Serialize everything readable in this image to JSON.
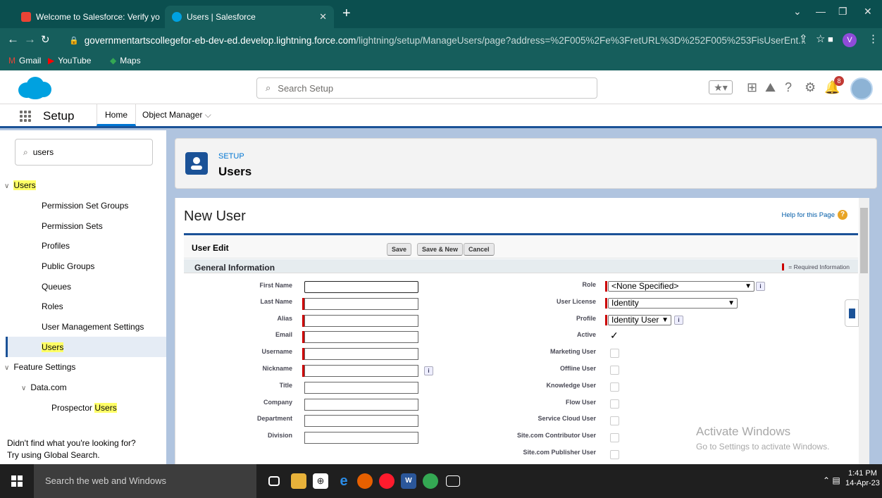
{
  "browser": {
    "tabs": [
      {
        "title": "Welcome to Salesforce: Verify yo",
        "active": false
      },
      {
        "title": "Users | Salesforce",
        "active": true
      }
    ],
    "url_main": "governmentartscollegefor-eb-dev-ed.develop.lightning.force.com",
    "url_path": "/lightning/setup/ManageUsers/page?address=%2F005%2Fe%3FretURL%3D%252F005%253FisUserEnt...",
    "profile_initial": "V",
    "bookmarks": [
      "Gmail",
      "YouTube",
      "Maps"
    ]
  },
  "header": {
    "search_placeholder": "Search Setup",
    "notification_count": "8"
  },
  "nav": {
    "app_name": "Setup",
    "tabs": [
      "Home",
      "Object Manager"
    ]
  },
  "sidebar": {
    "quickfind_value": "users",
    "group_users": "Users",
    "items": [
      "Permission Set Groups",
      "Permission Sets",
      "Profiles",
      "Public Groups",
      "Queues",
      "Roles",
      "User Management Settings",
      "Users"
    ],
    "feature_settings": "Feature Settings",
    "datacom": "Data.com",
    "prospector_prefix": "Prospector ",
    "prospector_highlight": "Users",
    "footer_line1": "Didn't find what you're looking for?",
    "footer_line2": "Try using Global Search."
  },
  "page_header": {
    "eyebrow": "SETUP",
    "title": "Users"
  },
  "form": {
    "title": "New User",
    "help_link": "Help for this Page",
    "section_title": "User Edit",
    "buttons": [
      "Save",
      "Save & New",
      "Cancel"
    ],
    "general_info": "General Information",
    "required_info": "= Required Information",
    "left_fields": [
      "First Name",
      "Last Name",
      "Alias",
      "Email",
      "Username",
      "Nickname",
      "Title",
      "Company",
      "Department",
      "Division"
    ],
    "right_fields": [
      "Role",
      "User License",
      "Profile",
      "Active",
      "Marketing User",
      "Offline User",
      "Knowledge User",
      "Flow User",
      "Service Cloud User",
      "Site.com Contributor User",
      "Site.com Publisher User"
    ],
    "role_value": "<None Specified>",
    "license_value": "Identity",
    "profile_value": "Identity User",
    "active_checked": true
  },
  "watermark": {
    "line1": "Activate Windows",
    "line2": "Go to Settings to activate Windows."
  },
  "taskbar": {
    "search_placeholder": "Search the web and Windows",
    "time": "1:41 PM",
    "date": "14-Apr-23"
  }
}
